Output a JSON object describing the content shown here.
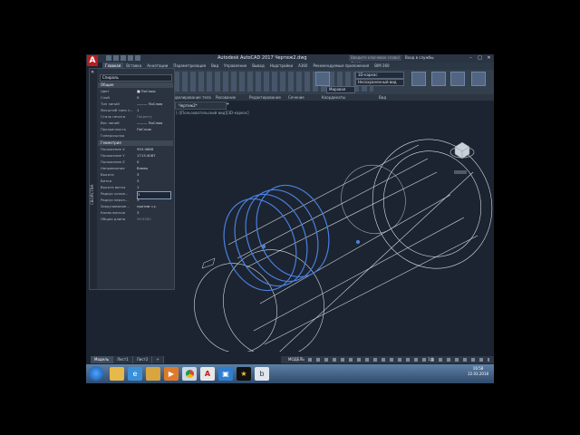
{
  "title": "Autodesk AutoCAD 2017    Чертеж2.dwg",
  "search_placeholder": "Введите ключевое слово/фразу",
  "signin": "Вход в службы",
  "window_buttons": [
    "–",
    "□",
    "✕"
  ],
  "tabs": [
    "Главная",
    "Вставка",
    "Аннотации",
    "Параметризация",
    "Вид",
    "Управление",
    "Вывод",
    "Надстройки",
    "A360",
    "Рекомендуемые приложения",
    "BIM 360"
  ],
  "active_tab": 0,
  "ribbon": {
    "panels": [
      "Моделирование тела",
      "Рисование",
      "Редактирование",
      "Сечение",
      "Координаты",
      "Вид"
    ],
    "visual_style": "3D-каркас",
    "view": "Несохраненный вид",
    "view_mode": "Мировая",
    "big_buttons": [
      "Секущая плоскость",
      "Выбор",
      "Слои",
      "Группы",
      "Вид"
    ]
  },
  "palette": {
    "vertical_label": "СВОЙСТВА",
    "close": "✕",
    "selection": "Спираль",
    "sections": [
      {
        "title": "Общие",
        "rows": [
          {
            "name": "Цвет",
            "value": "■ ПоСлою"
          },
          {
            "name": "Слой",
            "value": "0"
          },
          {
            "name": "Тип линий",
            "value": "——— ПоСлою"
          },
          {
            "name": "Масштаб типа л...",
            "value": "1"
          },
          {
            "name": "Стиль печати",
            "value": "ПоЦвету"
          },
          {
            "name": "Вес линий",
            "value": "——— ПоСлою"
          },
          {
            "name": "Прозрачность",
            "value": "ПоСлою"
          },
          {
            "name": "Гиперссылка",
            "value": ""
          }
        ]
      },
      {
        "title": "Геометрия",
        "rows": [
          {
            "name": "Положение X",
            "value": "993.0666"
          },
          {
            "name": "Положение Y",
            "value": "1713.4087"
          },
          {
            "name": "Положение Z",
            "value": "0"
          },
          {
            "name": "Направление",
            "value": "Влево"
          },
          {
            "name": "Высота",
            "value": "3"
          },
          {
            "name": "Витки",
            "value": "3"
          },
          {
            "name": "Высота витка",
            "value": "1"
          },
          {
            "name": "Радиус основ...",
            "value": "3"
          },
          {
            "name": "Радиус верхн...",
            "value": "3"
          },
          {
            "name": "Закручивание...",
            "value": "против ч.с."
          },
          {
            "name": "Колво витков",
            "value": "3"
          },
          {
            "name": "Общая длина",
            "value": "56.9282"
          }
        ]
      }
    ]
  },
  "doc_tab": "Чертеж2*",
  "viewport_label": "[-][Пользовательский вид][3D-каркас]",
  "layout_tabs": [
    "Модель",
    "Лист1",
    "Лист2",
    "+"
  ],
  "status": {
    "model": "МОДЕЛЬ",
    "scale": "1:1"
  },
  "taskbar": {
    "apps": [
      "IE",
      "Chrome",
      "AutoCAD"
    ],
    "time": "16:58",
    "date": "22.03.2018"
  }
}
